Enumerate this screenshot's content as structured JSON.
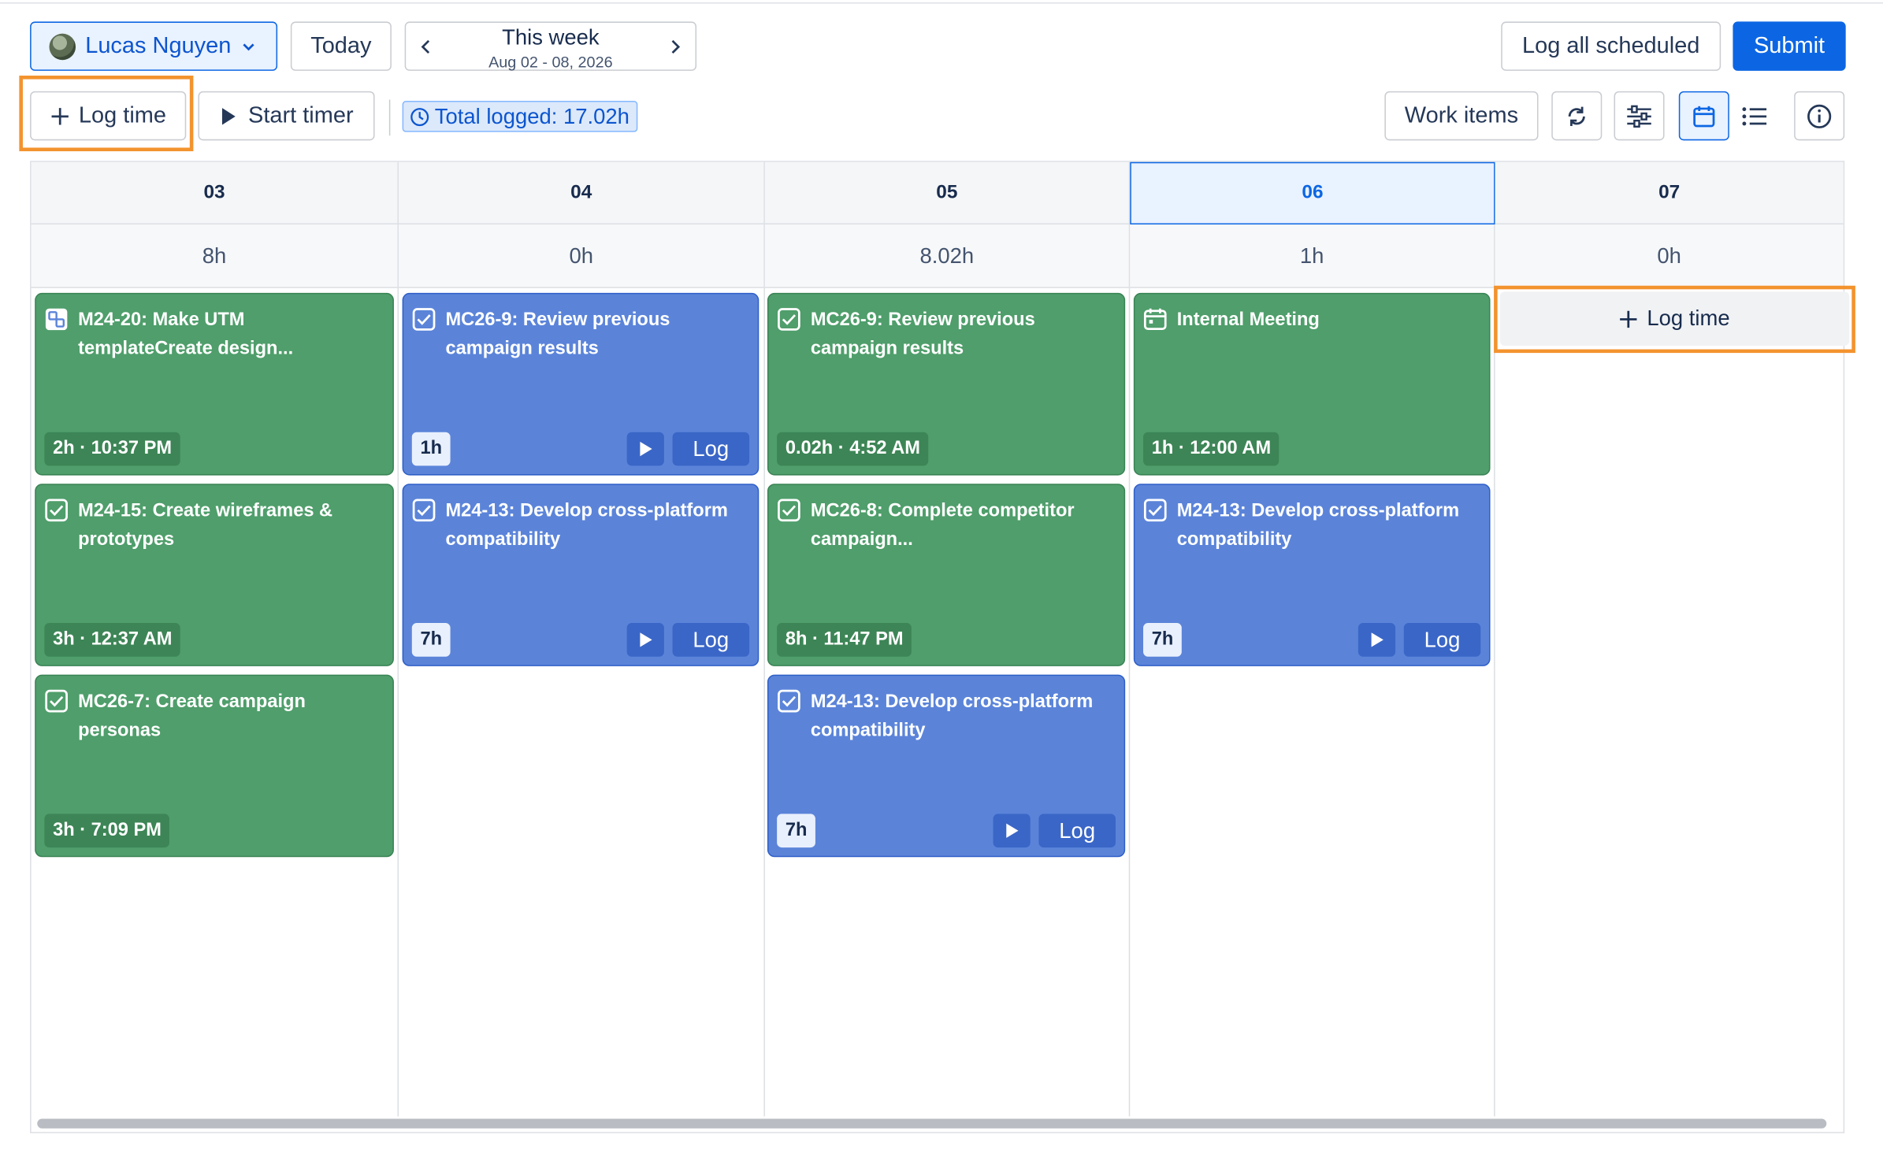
{
  "header": {
    "user_name": "Lucas Nguyen",
    "today_label": "Today",
    "week_title": "This week",
    "week_range": "Aug 02 - 08, 2026",
    "log_all_label": "Log all scheduled",
    "submit_label": "Submit"
  },
  "toolbar": {
    "log_time_label": "Log time",
    "start_timer_label": "Start timer",
    "total_logged": "Total logged: 17.02h",
    "work_items_label": "Work items"
  },
  "days": [
    {
      "date": "03",
      "total": "8h"
    },
    {
      "date": "04",
      "total": "0h"
    },
    {
      "date": "05",
      "total": "8.02h"
    },
    {
      "date": "06",
      "total": "1h"
    },
    {
      "date": "07",
      "total": "0h"
    }
  ],
  "entries": {
    "d03": [
      {
        "title": "M24-20: Make UTM templateCreate design...",
        "badge": "2h · 10:37 PM",
        "icon": "subtask-icon"
      },
      {
        "title": "M24-15: Create wireframes & prototypes",
        "badge": "3h · 12:37 AM",
        "icon": "checkbox-icon"
      },
      {
        "title": "MC26-7: Create campaign personas",
        "badge": "3h · 7:09 PM",
        "icon": "checkbox-icon"
      }
    ],
    "d04": [
      {
        "title": "MC26-9: Review previous campaign results",
        "badge": "1h",
        "icon": "checkbox-icon",
        "log": "Log"
      },
      {
        "title": "M24-13: Develop cross-platform compatibility",
        "badge": "7h",
        "icon": "checkbox-icon",
        "log": "Log"
      }
    ],
    "d05": [
      {
        "title": "MC26-9: Review previous campaign results",
        "badge": "0.02h · 4:52 AM",
        "icon": "checkbox-icon"
      },
      {
        "title": "MC26-8: Complete competitor campaign...",
        "badge": "8h · 11:47 PM",
        "icon": "checkbox-icon"
      },
      {
        "title": "M24-13: Develop cross-platform compatibility",
        "badge": "7h",
        "icon": "checkbox-icon",
        "log": "Log"
      }
    ],
    "d06": [
      {
        "title": "Internal Meeting",
        "badge": "1h · 12:00 AM",
        "icon": "calendar-icon"
      },
      {
        "title": "M24-13: Develop cross-platform compatibility",
        "badge": "7h",
        "icon": "checkbox-icon",
        "log": "Log"
      }
    ],
    "d07_log_time_label": "Log time"
  },
  "colors": {
    "primary": "#0c66e4",
    "logged_green": "#4f9e6b",
    "scheduled_blue": "#5b84d9",
    "highlight_orange": "#f3932e"
  }
}
